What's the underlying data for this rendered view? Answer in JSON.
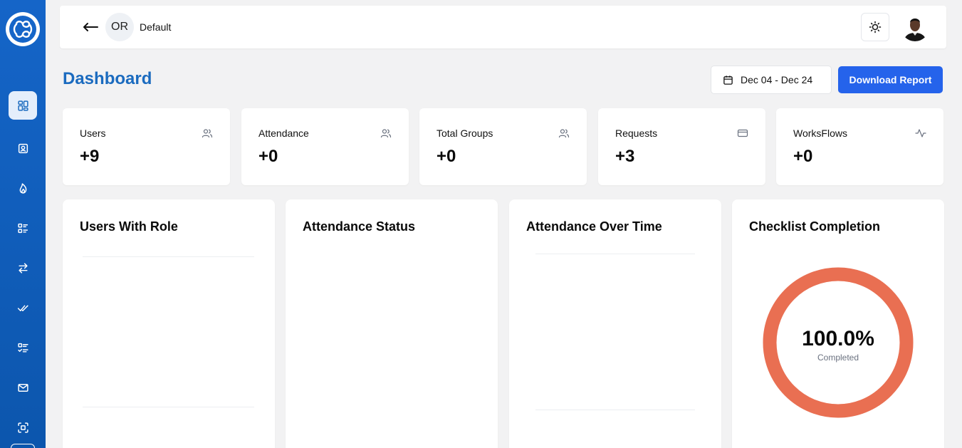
{
  "theme": {
    "accent": "#2563eb",
    "sidebar": "#1565c8",
    "title": "#1b6bbf",
    "donut": "#e96f52"
  },
  "sidebar": {
    "items": [
      {
        "icon": "dashboard-icon",
        "active": true
      },
      {
        "icon": "contact-badge-icon"
      },
      {
        "icon": "flame-icon"
      },
      {
        "icon": "list-icon"
      },
      {
        "icon": "transfer-arrows-icon"
      },
      {
        "icon": "double-check-icon"
      },
      {
        "icon": "checklist-icon"
      },
      {
        "icon": "mail-icon"
      },
      {
        "icon": "scan-icon"
      }
    ]
  },
  "header": {
    "org_initials": "OR",
    "org_name": "Default"
  },
  "page": {
    "title": "Dashboard",
    "date_range": "Dec 04 - Dec 24",
    "download_label": "Download Report"
  },
  "stats": [
    {
      "label": "Users",
      "value": "+9",
      "icon": "users-icon"
    },
    {
      "label": "Attendance",
      "value": "+0",
      "icon": "users-icon"
    },
    {
      "label": "Total Groups",
      "value": "+0",
      "icon": "users-icon"
    },
    {
      "label": "Requests",
      "value": "+3",
      "icon": "credit-card-icon"
    },
    {
      "label": "WorksFlows",
      "value": "+0",
      "icon": "activity-icon"
    }
  ],
  "panels": {
    "users_with_role": {
      "title": "Users With Role"
    },
    "attendance_status": {
      "title": "Attendance Status"
    },
    "attendance_over_time": {
      "title": "Attendance Over Time"
    },
    "checklist": {
      "title": "Checklist Completion",
      "value": "100.0%",
      "caption": "Completed",
      "completion": 1.0
    }
  }
}
